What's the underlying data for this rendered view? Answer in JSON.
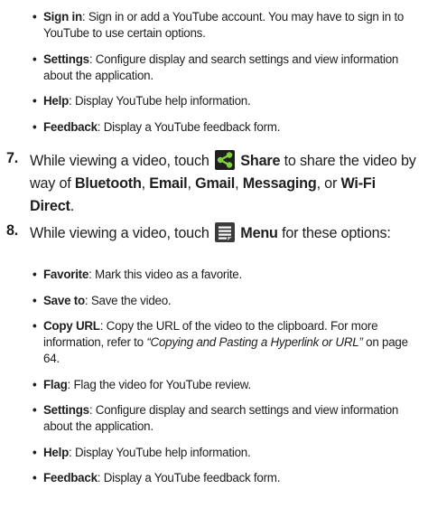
{
  "list_a": [
    {
      "term": "Sign in",
      "desc": ": Sign in or add a YouTube account. You may have to sign in to YouTube to use certain options."
    },
    {
      "term": "Settings",
      "desc": ": Configure display and search settings and view information about the application."
    },
    {
      "term": "Help",
      "desc": ": Display YouTube help information."
    },
    {
      "term": "Feedback",
      "desc": ": Display a YouTube feedback form."
    }
  ],
  "step7": {
    "number": "7.",
    "text_before": "While viewing a video, touch",
    "icon": "share-icon",
    "action": "Share",
    "text_after": "to share the video by way of",
    "opt1": "Bluetooth",
    "sep1": ",",
    "opt2": "Email",
    "sep2": ",",
    "opt3": "Gmail",
    "sep3": ",",
    "opt4": "Messaging",
    "sep4": ", or",
    "opt5": "Wi-Fi Direct",
    "end": "."
  },
  "step8": {
    "number": "8.",
    "text_before": "While viewing a video, touch",
    "icon": "menu-icon",
    "action": "Menu",
    "text_after": "for these options:"
  },
  "list_b": [
    {
      "term": "Favorite",
      "desc": ": Mark this video as a favorite."
    },
    {
      "term": "Save to",
      "desc": ": Save the video."
    },
    {
      "term": "Copy URL",
      "desc": ": Copy the URL of the video to the clipboard. For more information, refer to ",
      "link": "“Copying and Pasting a Hyperlink or URL”",
      "after": "  on page 64."
    },
    {
      "term": "Flag",
      "desc": ": Flag the video for YouTube review."
    },
    {
      "term": "Settings",
      "desc": ": Configure display and search settings and view information about the application."
    },
    {
      "term": "Help",
      "desc": ": Display YouTube help information."
    },
    {
      "term": "Feedback",
      "desc": ": Display a YouTube feedback form."
    }
  ],
  "colors": {
    "text": "#1e1e1e",
    "share_icon_bg": "#1f1f1f",
    "share_icon_fg": "#7fd13b",
    "menu_icon_bg": "#3b3b3b",
    "menu_icon_lines": "#ffffff"
  }
}
